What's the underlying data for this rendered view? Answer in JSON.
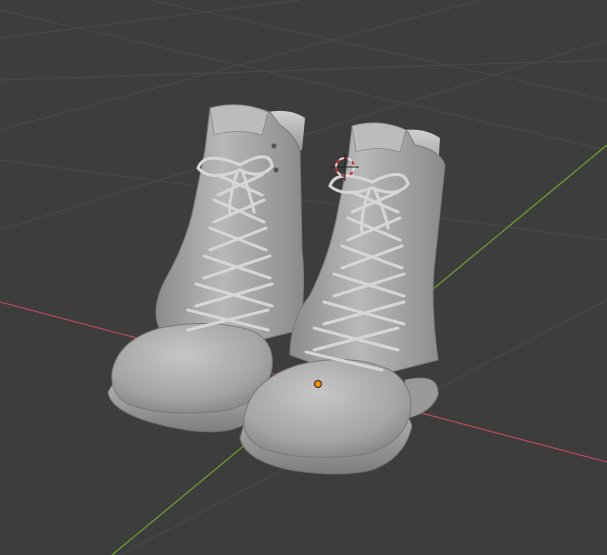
{
  "viewport": {
    "mode": "3D Viewport",
    "shading": "solid",
    "background_color": "#3d3d3d",
    "grid_color": "#4a4a4a",
    "x_axis_color": "#b34a57",
    "y_axis_color": "#6b9a2e",
    "origin_color": "#ff8c00",
    "cursor_color": "#cc3333"
  },
  "scene": {
    "objects": [
      {
        "name": "boot-left",
        "type": "mesh",
        "material_color": "#a8a8a8"
      },
      {
        "name": "boot-right",
        "type": "mesh",
        "material_color": "#a8a8a8"
      }
    ]
  }
}
